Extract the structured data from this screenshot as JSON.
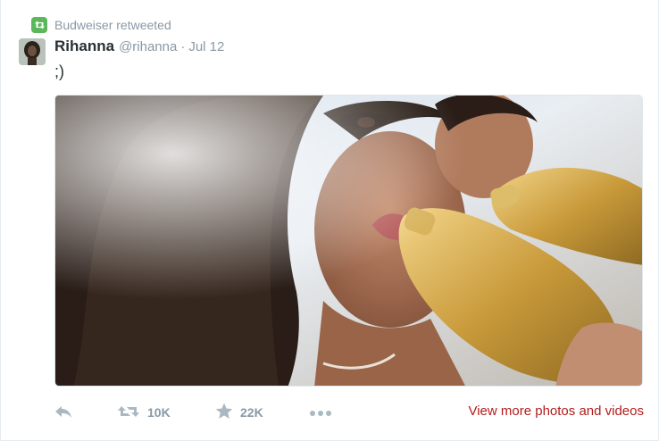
{
  "retweet_context": {
    "label": "Budweiser retweeted",
    "icon": "retweet-icon",
    "badge_color": "#5bb75b"
  },
  "tweet": {
    "fullname": "Rihanna",
    "username": "@rihanna",
    "separator": "·",
    "time": "Jul 12",
    "text": ";)",
    "media_alt": "Selfie photo with two people drinking from gold beer bottles"
  },
  "actions": {
    "reply": {
      "icon": "reply-icon"
    },
    "retweet": {
      "icon": "retweet-icon",
      "count": "10K"
    },
    "favorite": {
      "icon": "star-icon",
      "count": "22K"
    },
    "more": {
      "icon": "more-icon"
    }
  },
  "view_more": {
    "label": "View more photos and videos",
    "color": "#b31c1c"
  }
}
